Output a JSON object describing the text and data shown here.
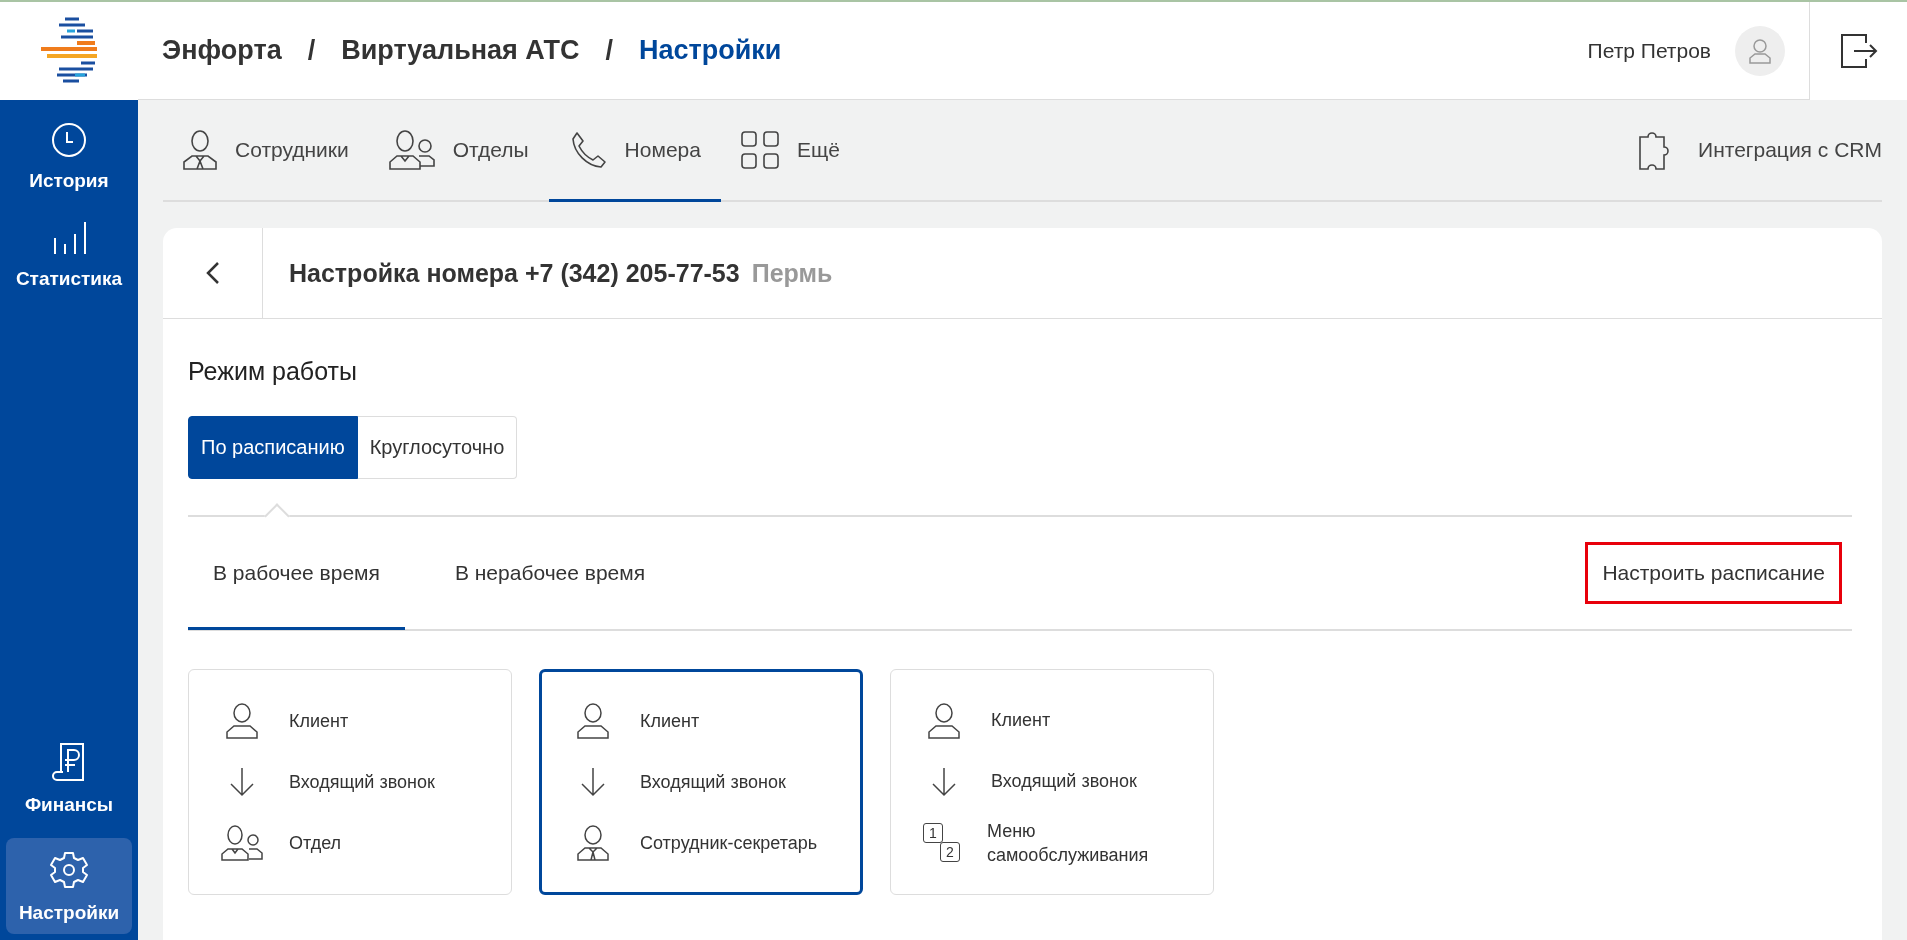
{
  "breadcrumb": [
    {
      "label": "Энфорта",
      "selected": false
    },
    {
      "label": "Виртуальная АТС",
      "selected": false
    },
    {
      "label": "Настройки",
      "selected": true
    }
  ],
  "breadcrumb_separator": "/",
  "user": {
    "name": "Петр Петров"
  },
  "sidebar": {
    "items": [
      {
        "label": "История",
        "kind": "clock",
        "selected": false
      },
      {
        "label": "Статистика",
        "kind": "bars",
        "selected": false
      },
      {
        "label": "Финансы",
        "kind": "finance",
        "selected": false
      },
      {
        "label": "Настройки",
        "kind": "gear",
        "selected": true
      }
    ]
  },
  "tabs": [
    {
      "label": "Сотрудники",
      "kind": "person",
      "selected": false
    },
    {
      "label": "Отделы",
      "kind": "group",
      "selected": false
    },
    {
      "label": "Номера",
      "kind": "phone",
      "selected": true
    },
    {
      "label": "Ещё",
      "kind": "grid",
      "selected": false
    }
  ],
  "crm_link": "Интеграция с CRM",
  "page": {
    "title": "Настройка номера +7 (342) 205-77-53",
    "city": "Пермь",
    "section_title": "Режим работы",
    "mode_options": [
      {
        "label": "По расписанию",
        "selected": true
      },
      {
        "label": "Круглосуточно",
        "selected": false
      }
    ],
    "time_tabs": [
      {
        "label": "В рабочее время",
        "selected": true
      },
      {
        "label": "В нерабочее время",
        "selected": false
      }
    ],
    "schedule_button": {
      "label": "Настроить расписание",
      "highlighted": true
    },
    "scenarios": [
      {
        "selected": false,
        "steps": [
          {
            "kind": "person",
            "label": "Клиент"
          },
          {
            "kind": "arrow",
            "label": "Входящий звонок"
          },
          {
            "kind": "group",
            "label": "Отдел"
          }
        ]
      },
      {
        "selected": true,
        "steps": [
          {
            "kind": "person",
            "label": "Клиент"
          },
          {
            "kind": "arrow",
            "label": "Входящий звонок"
          },
          {
            "kind": "employee",
            "label": "Сотрудник-секретарь"
          }
        ]
      },
      {
        "selected": false,
        "steps": [
          {
            "kind": "person",
            "label": "Клиент"
          },
          {
            "kind": "arrow",
            "label": "Входящий звонок"
          },
          {
            "kind": "menu",
            "label": "Меню самообслуживания",
            "digits": [
              "1",
              "2"
            ]
          }
        ]
      }
    ]
  }
}
